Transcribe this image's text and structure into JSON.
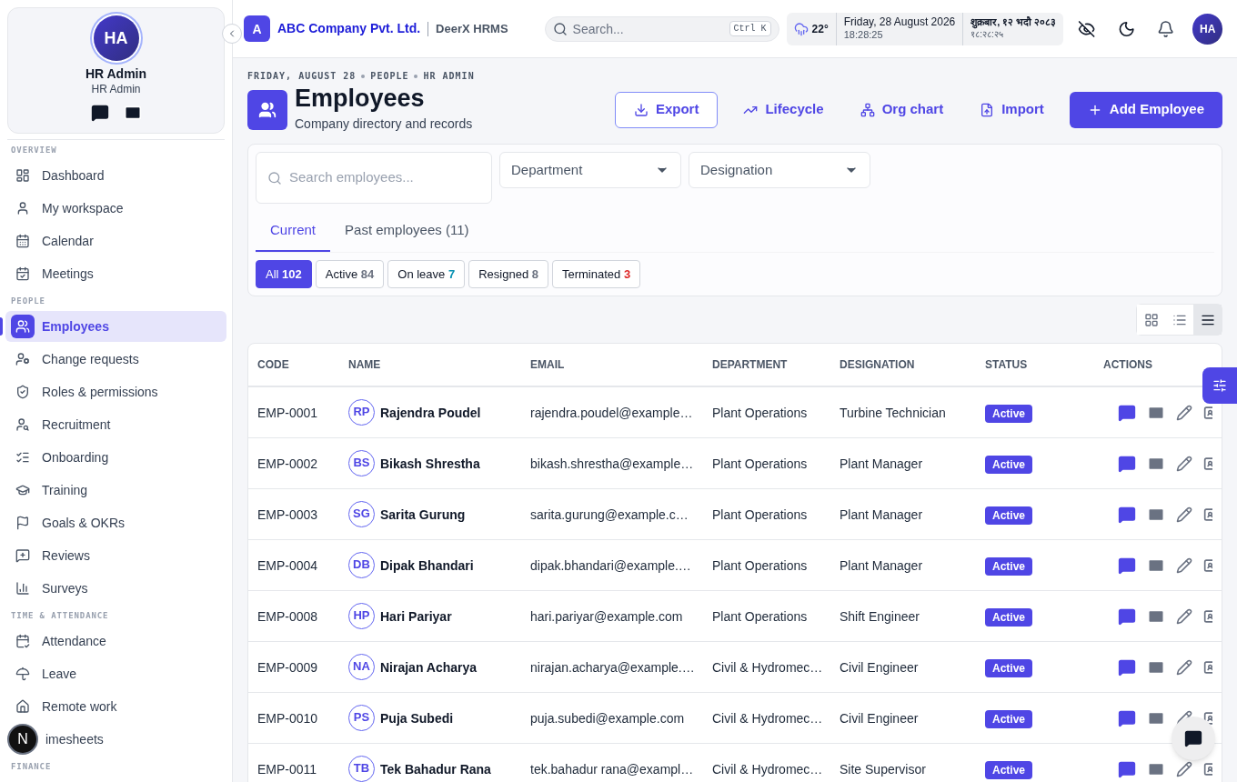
{
  "profile": {
    "initials": "HA",
    "name": "HR Admin",
    "role": "HR Admin"
  },
  "nav": [
    {
      "section": "OVERVIEW",
      "items": [
        {
          "label": "Dashboard",
          "selected": false
        },
        {
          "label": "My workspace",
          "selected": false
        },
        {
          "label": "Calendar",
          "selected": false
        },
        {
          "label": "Meetings",
          "selected": false
        }
      ]
    },
    {
      "section": "PEOPLE",
      "items": [
        {
          "label": "Employees",
          "selected": true
        },
        {
          "label": "Change requests",
          "selected": false
        },
        {
          "label": "Roles & permissions",
          "selected": false
        },
        {
          "label": "Recruitment",
          "selected": false
        },
        {
          "label": "Onboarding",
          "selected": false
        },
        {
          "label": "Training",
          "selected": false
        },
        {
          "label": "Goals & OKRs",
          "selected": false
        },
        {
          "label": "Reviews",
          "selected": false
        },
        {
          "label": "Surveys",
          "selected": false
        }
      ]
    },
    {
      "section": "TIME & ATTENDANCE",
      "items": [
        {
          "label": "Attendance",
          "selected": false
        },
        {
          "label": "Leave",
          "selected": false
        },
        {
          "label": "Remote work",
          "selected": false
        },
        {
          "label": "imesheets",
          "selected": false,
          "badge": "N"
        }
      ]
    },
    {
      "section": "FINANCE"
    }
  ],
  "topbar": {
    "logo": "A",
    "company": "ABC Company Pvt. Ltd.",
    "product": "DeerX HRMS",
    "search_placeholder": "Search...",
    "shortcut": "Ctrl K",
    "temperature": "22°",
    "date": "Friday, 28 August 2026",
    "time": "18:28:25",
    "nepali_date": "शुक्रबार, १२ भदौ २०८३",
    "nepali_time": "१८:२८:२५",
    "avatar": "HA"
  },
  "breadcrumb": [
    "FRIDAY, AUGUST 28",
    "PEOPLE",
    "HR ADMIN"
  ],
  "page": {
    "title": "Employees",
    "subtitle": "Company directory and records"
  },
  "actions": [
    {
      "label": "Export",
      "kind": "outline"
    },
    {
      "label": "Lifecycle",
      "kind": "link"
    },
    {
      "label": "Org chart",
      "kind": "link"
    },
    {
      "label": "Import",
      "kind": "link"
    },
    {
      "label": "Add Employee",
      "kind": "primary"
    }
  ],
  "filters": {
    "search_placeholder": "Search employees...",
    "department": "Department",
    "designation": "Designation"
  },
  "tabs": [
    {
      "label": "Current",
      "selected": true
    },
    {
      "label": "Past employees (11)",
      "selected": false
    }
  ],
  "chips": [
    {
      "label": "All",
      "count": "102",
      "selected": true
    },
    {
      "label": "Active",
      "count": "84",
      "selected": false,
      "color": "#6b7280"
    },
    {
      "label": "On leave",
      "count": "7",
      "selected": false,
      "color": "#0891b2"
    },
    {
      "label": "Resigned",
      "count": "8",
      "selected": false,
      "color": "#6b7280"
    },
    {
      "label": "Terminated",
      "count": "3",
      "selected": false,
      "color": "#dc2626"
    }
  ],
  "views": [
    {
      "selected": false
    },
    {
      "selected": false
    },
    {
      "selected": true
    }
  ],
  "table": {
    "columns": [
      "CODE",
      "NAME",
      "EMAIL",
      "DEPARTMENT",
      "DESIGNATION",
      "STATUS",
      "ACTIONS"
    ],
    "rows": [
      {
        "code": "EMP-0001",
        "initials": "RP",
        "name": "Rajendra Poudel",
        "email": "rajendra.poudel@example…",
        "department": "Plant Operations",
        "designation": "Turbine Technician",
        "status": "Active"
      },
      {
        "code": "EMP-0002",
        "initials": "BS",
        "name": "Bikash Shrestha",
        "email": "bikash.shrestha@example…",
        "department": "Plant Operations",
        "designation": "Plant Manager",
        "status": "Active"
      },
      {
        "code": "EMP-0003",
        "initials": "SG",
        "name": "Sarita Gurung",
        "email": "sarita.gurung@example.c…",
        "department": "Plant Operations",
        "designation": "Plant Manager",
        "status": "Active"
      },
      {
        "code": "EMP-0004",
        "initials": "DB",
        "name": "Dipak Bhandari",
        "email": "dipak.bhandari@example.…",
        "department": "Plant Operations",
        "designation": "Plant Manager",
        "status": "Active"
      },
      {
        "code": "EMP-0008",
        "initials": "HP",
        "name": "Hari Pariyar",
        "email": "hari.pariyar@example.com",
        "department": "Plant Operations",
        "designation": "Shift Engineer",
        "status": "Active"
      },
      {
        "code": "EMP-0009",
        "initials": "NA",
        "name": "Nirajan Acharya",
        "email": "nirajan.acharya@example.…",
        "department": "Civil & Hydromec…",
        "designation": "Civil Engineer",
        "status": "Active"
      },
      {
        "code": "EMP-0010",
        "initials": "PS",
        "name": "Puja Subedi",
        "email": "puja.subedi@example.com",
        "department": "Civil & Hydromec…",
        "designation": "Civil Engineer",
        "status": "Active"
      },
      {
        "code": "EMP-0011",
        "initials": "TB",
        "name": "Tek Bahadur Rana",
        "email": "tek.bahadur rana@exampl…",
        "department": "Civil & Hydromec…",
        "designation": "Site Supervisor",
        "status": "Active"
      }
    ]
  }
}
